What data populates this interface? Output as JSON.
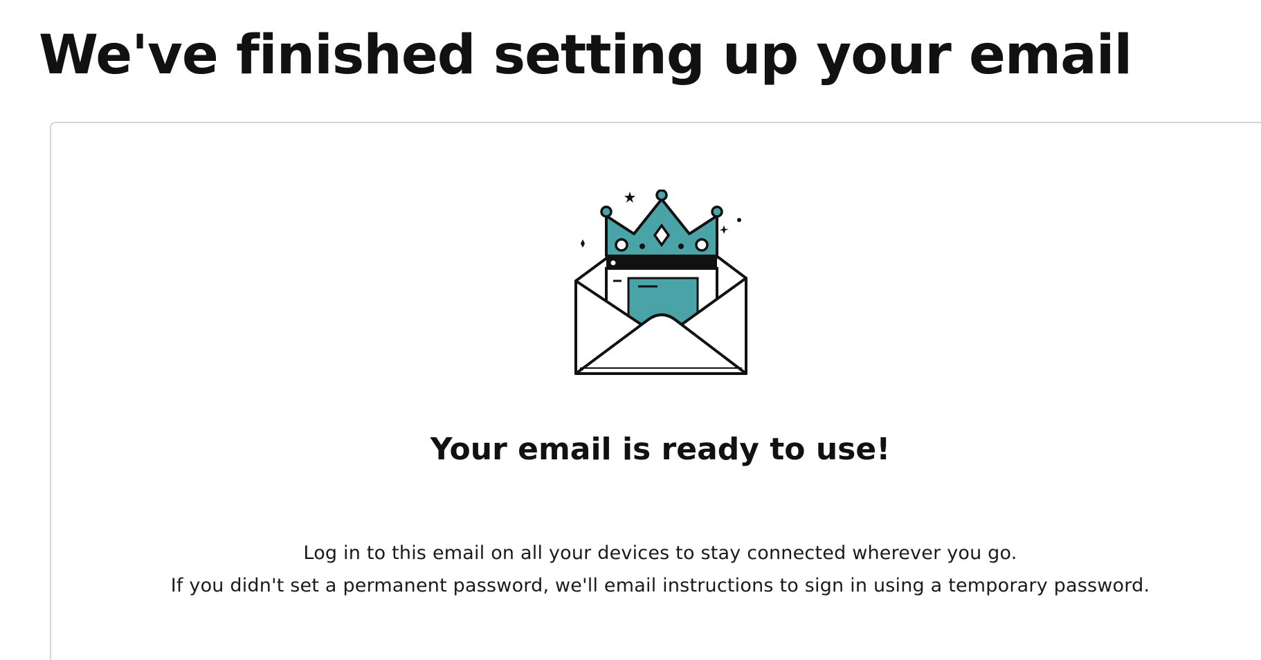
{
  "page": {
    "title": "We've finished setting up your email"
  },
  "card": {
    "illustration_icon": "envelope-with-crown-icon",
    "heading": "Your email is ready to use!",
    "description_line_1": "Log in to this email on all your devices to stay connected wherever you go.",
    "description_line_2": "If you didn't set a permanent password, we'll email instructions to sign in using a temporary password."
  },
  "colors": {
    "teal": "#4aa3a7",
    "ink": "#111111",
    "card_border": "#d6d6d6"
  }
}
